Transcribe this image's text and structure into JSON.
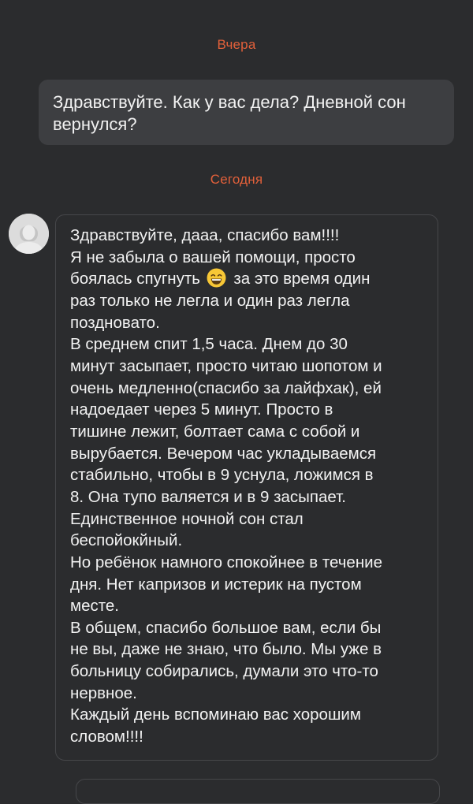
{
  "chat": {
    "date_yesterday": "Вчера",
    "date_today": "Сегодня",
    "outgoing": {
      "lines": [
        "Здравствуйте. Как у вас дела? Дневной сон",
        "вернулся?"
      ]
    },
    "incoming": {
      "lines": [
        "Здравствуйте, дааа, спасибо вам!!!!",
        "Я не забыла о вашей помощи, просто",
        "боялась спугнуть",
        "за это время один",
        "раз только не легла и один раз легла",
        "поздновато.",
        "В среднем спит 1,5 часа. Днем до 30",
        "минут засыпает, просто читаю шопотом и",
        "очень медленно(спасибо за лайфхак), ей",
        "надоедает через 5 минут. Просто в",
        "тишине лежит, болтает сама с собой и",
        "вырубается. Вечером час укладываемся",
        "стабильно, чтобы в 9 уснула, ложимся в",
        "8. Она тупо валяется и в 9 засыпает.",
        "Единственное ночной сон стал",
        "беспойокйный.",
        "Но ребёнок намного спокойнее в течение",
        "дня. Нет капризов и истерик на пустом",
        "месте.",
        "В общем, спасибо большое вам, если бы",
        "не вы, даже не знаю, что было. Мы уже в",
        "больницу собирались, думали это что-то",
        "нервное.",
        "Каждый день вспоминаю вас хорошим",
        "словом!!!!"
      ],
      "emoji": "grinning-face-with-smiling-eyes-icon"
    }
  },
  "colors": {
    "background": "#2b2c2e",
    "date_accent": "#e2603a",
    "outgoing_bubble": "#3d3e41",
    "text": "#f2f2f2"
  }
}
